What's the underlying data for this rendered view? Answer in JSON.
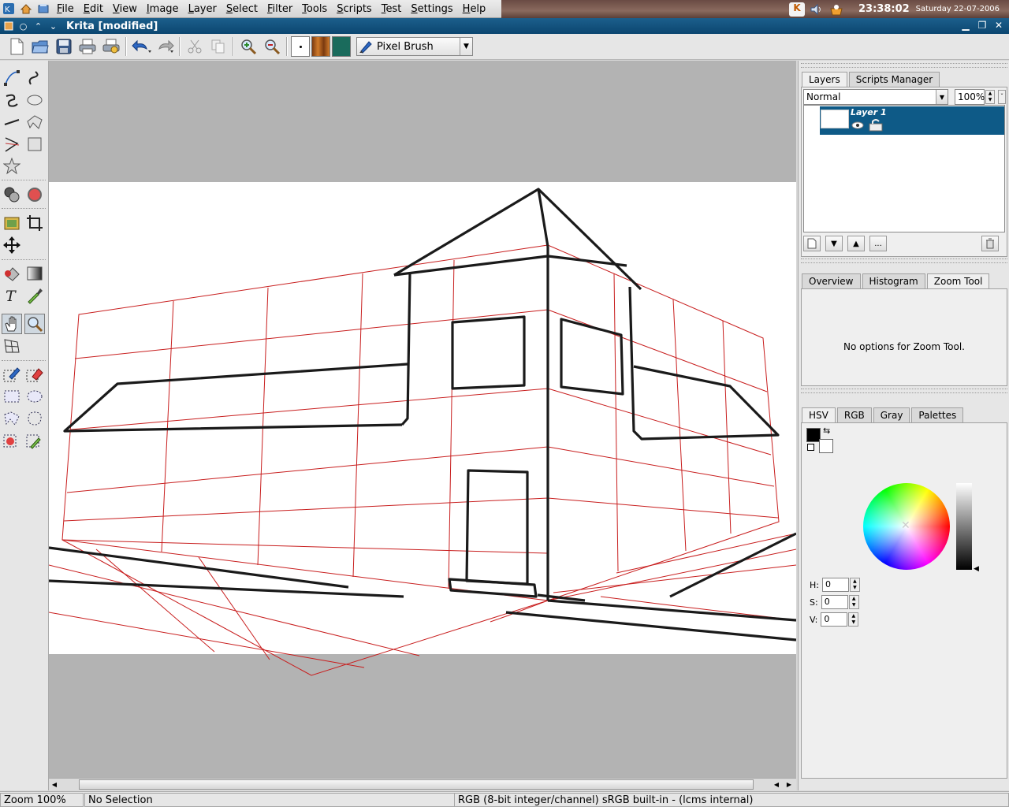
{
  "menubar": {
    "items": [
      "File",
      "Edit",
      "View",
      "Image",
      "Layer",
      "Select",
      "Filter",
      "Tools",
      "Scripts",
      "Test",
      "Settings",
      "Help"
    ]
  },
  "tray": {
    "clock": "23:38:02",
    "date": "Saturday 22-07-2006"
  },
  "window": {
    "title": "Krita [modified]"
  },
  "toolbar": {
    "brush_preset": "Pixel Brush",
    "icons": [
      "new-icon",
      "open-icon",
      "save-icon",
      "print-icon",
      "print-preview-icon",
      "undo-icon",
      "redo-icon",
      "cut-icon",
      "copy-icon",
      "zoom-in-icon",
      "zoom-out-icon"
    ],
    "brush_color": "#ffffff",
    "gradient_color": "#b8621e",
    "pattern_color": "#1a6b5c"
  },
  "layers_panel": {
    "tabs": [
      "Layers",
      "Scripts Manager"
    ],
    "blend_mode": "Normal",
    "opacity": "100%",
    "layers": [
      {
        "name": "Layer 1",
        "selected": true
      }
    ],
    "buttons": [
      "new-layer-button",
      "move-layer-down-button",
      "move-layer-up-button",
      "layer-properties-button",
      "delete-layer-button"
    ],
    "more_label": "..."
  },
  "tool_options_panel": {
    "tabs": [
      "Overview",
      "Histogram",
      "Zoom Tool"
    ],
    "message": "No options for Zoom Tool."
  },
  "color_panel": {
    "tabs": [
      "HSV",
      "RGB",
      "Gray",
      "Palettes"
    ],
    "foreground": "#000000",
    "background": "#ffffff",
    "h_label": "H:",
    "h_value": "0",
    "s_label": "S:",
    "s_value": "0",
    "v_label": "V:",
    "v_value": "0"
  },
  "statusbar": {
    "zoom": "Zoom 100%",
    "selection": "No Selection",
    "colorspace": "RGB (8-bit integer/channel)  sRGB built-in - (lcms internal)"
  },
  "colors": {
    "accent": "#0e5a87",
    "grid_red": "#c81e1e",
    "canvas_bg": "#b3b3b3"
  }
}
